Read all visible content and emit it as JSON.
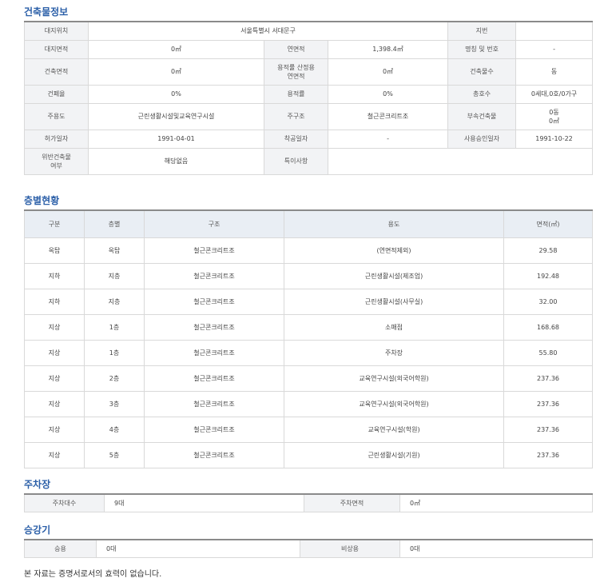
{
  "building_info": {
    "title": "건축물정보",
    "rows": [
      [
        {
          "t": "대지위치",
          "l": true
        },
        {
          "t": "서울특별시 서대문구",
          "span": 3
        },
        {
          "t": "지번",
          "l": true
        },
        {
          "t": ""
        }
      ],
      [
        {
          "t": "대지면적",
          "l": true
        },
        {
          "t": "0㎡"
        },
        {
          "t": "연면적",
          "l": true
        },
        {
          "t": "1,398.4㎡"
        },
        {
          "t": "명칭 및 번호",
          "l": true
        },
        {
          "t": "-"
        }
      ],
      [
        {
          "t": "건축면적",
          "l": true
        },
        {
          "t": "0㎡"
        },
        {
          "t": "용적률 산정용\n연면적",
          "l": true
        },
        {
          "t": "0㎡"
        },
        {
          "t": "건축물수",
          "l": true
        },
        {
          "t": "동"
        }
      ],
      [
        {
          "t": "건폐율",
          "l": true
        },
        {
          "t": "0%"
        },
        {
          "t": "용적률",
          "l": true
        },
        {
          "t": "0%"
        },
        {
          "t": "총호수",
          "l": true
        },
        {
          "t": "0세대,0호/0가구"
        }
      ],
      [
        {
          "t": "주용도",
          "l": true
        },
        {
          "t": "근린생활시설및교육연구시설"
        },
        {
          "t": "주구조",
          "l": true
        },
        {
          "t": "철근콘크리트조"
        },
        {
          "t": "부속건축물",
          "l": true
        },
        {
          "t": "0동\n0㎡"
        }
      ],
      [
        {
          "t": "허가일자",
          "l": true
        },
        {
          "t": "1991-04-01"
        },
        {
          "t": "착공일자",
          "l": true
        },
        {
          "t": "-"
        },
        {
          "t": "사용승인일자",
          "l": true
        },
        {
          "t": "1991-10-22"
        }
      ],
      [
        {
          "t": "위반건축물\n여부",
          "l": true
        },
        {
          "t": "해당없음"
        },
        {
          "t": "특이사항",
          "l": true
        },
        {
          "t": "",
          "span": 3
        }
      ]
    ]
  },
  "floor_status": {
    "title": "층별현황",
    "headers": [
      "구분",
      "층별",
      "구조",
      "용도",
      "면적(㎡)"
    ],
    "rows": [
      [
        "옥탑",
        "옥탑",
        "철근콘크리트조",
        "(연면적제외)",
        "29.58"
      ],
      [
        "지하",
        "지층",
        "철근콘크리트조",
        "근린생활시설(제조업)",
        "192.48"
      ],
      [
        "지하",
        "지층",
        "철근콘크리트조",
        "근린생활시설(사무실)",
        "32.00"
      ],
      [
        "지상",
        "1층",
        "철근콘크리트조",
        "소매점",
        "168.68"
      ],
      [
        "지상",
        "1층",
        "철근콘크리트조",
        "주차장",
        "55.80"
      ],
      [
        "지상",
        "2층",
        "철근콘크리트조",
        "교육연구시설(외국어학원)",
        "237.36"
      ],
      [
        "지상",
        "3층",
        "철근콘크리트조",
        "교육연구시설(외국어학원)",
        "237.36"
      ],
      [
        "지상",
        "4층",
        "철근콘크리트조",
        "교육연구시설(학원)",
        "237.36"
      ],
      [
        "지상",
        "5층",
        "철근콘크리트조",
        "근린생활시설(기원)",
        "237.36"
      ]
    ]
  },
  "parking": {
    "title": "주차장",
    "count_label": "주차대수",
    "count_value": "9대",
    "area_label": "주차면적",
    "area_value": "0㎡"
  },
  "elevator": {
    "title": "승강기",
    "passenger_label": "승용",
    "passenger_value": "0대",
    "emergency_label": "비상용",
    "emergency_value": "0대"
  },
  "footnote": "본 자료는 증명서로서의 효력이 없습니다."
}
